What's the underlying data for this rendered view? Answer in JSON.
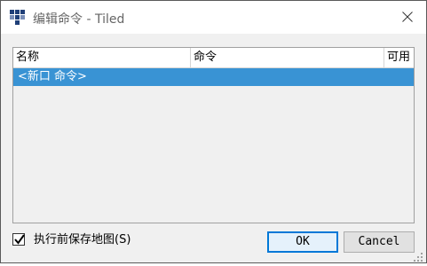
{
  "window": {
    "title": "编辑命令 - Tiled",
    "app_icon": "tiled-icon",
    "close_icon": "close-icon"
  },
  "table": {
    "columns": [
      "名称",
      "命令",
      "可用"
    ],
    "rows": [
      {
        "name": "<新口 命令>",
        "command": "",
        "enabled": "",
        "selected": true
      }
    ]
  },
  "options": {
    "save_before_execute_label": "执行前保存地图(S)",
    "save_before_execute_checked": true
  },
  "buttons": {
    "ok_label": "OK",
    "cancel_label": "Cancel"
  },
  "colors": {
    "selection": "#3993d4",
    "default_button_border": "#0078d7",
    "app_icon": "#1f3f78"
  }
}
